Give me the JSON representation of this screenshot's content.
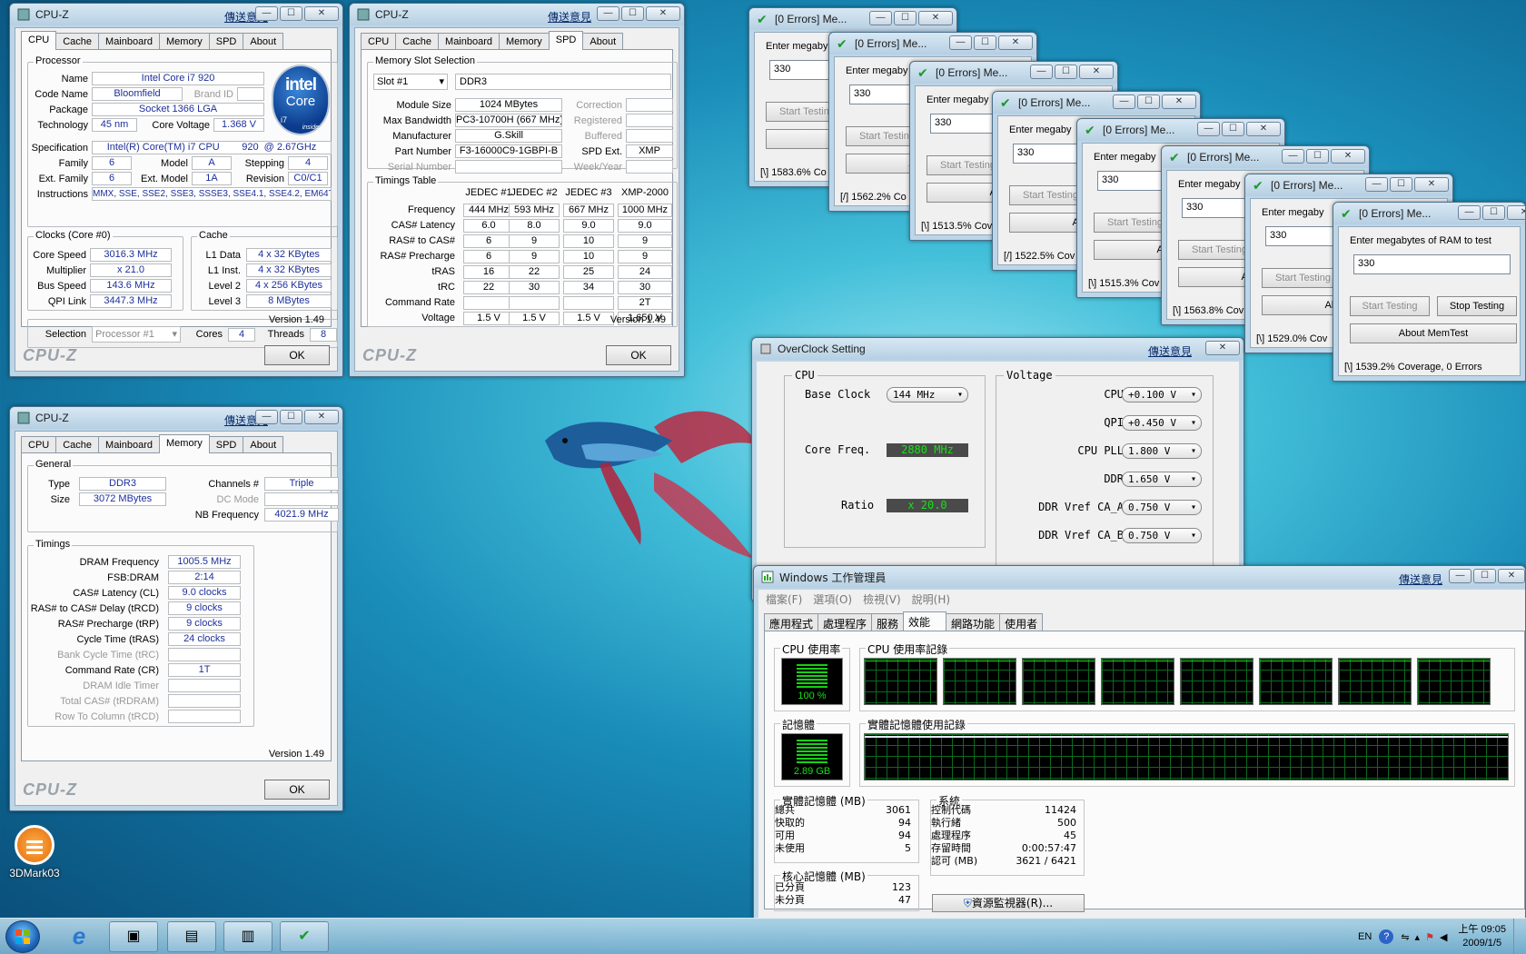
{
  "send_link": "傳送意見",
  "cpuz_logo": "CPU-Z",
  "cpuz_title": "CPU-Z",
  "cpuz_tabs": [
    "CPU",
    "Cache",
    "Mainboard",
    "Memory",
    "SPD",
    "About"
  ],
  "cpuz_version": "Version 1.49",
  "ok_label": "OK",
  "intel_logo": {
    "brand": "intel",
    "sub": "Core",
    "model": "i7",
    "inside": "inside"
  },
  "cpu": {
    "processor_group": "Processor",
    "name_label": "Name",
    "name": "Intel Core i7 920",
    "codename_label": "Code Name",
    "codename": "Bloomfield",
    "brandid_label": "Brand ID",
    "package_label": "Package",
    "package": "Socket 1366 LGA",
    "technology_label": "Technology",
    "technology": "45 nm",
    "core_voltage_label": "Core Voltage",
    "core_voltage": "1.368 V",
    "spec_label": "Specification",
    "spec": "Intel(R) Core(TM) i7 CPU        920  @ 2.67GHz",
    "family_label": "Family",
    "family": "6",
    "model_label": "Model",
    "model": "A",
    "stepping_label": "Stepping",
    "stepping": "4",
    "extfamily_label": "Ext. Family",
    "extfamily": "6",
    "extmodel_label": "Ext. Model",
    "extmodel": "1A",
    "revision_label": "Revision",
    "revision": "C0/C1",
    "instructions_label": "Instructions",
    "instructions": "MMX, SSE, SSE2, SSE3, SSSE3, SSE4.1, SSE4.2, EM64T",
    "clocks_group": "Clocks (Core #0)",
    "core_speed_label": "Core Speed",
    "core_speed": "3016.3 MHz",
    "multiplier_label": "Multiplier",
    "multiplier": "x 21.0",
    "bus_speed_label": "Bus Speed",
    "bus_speed": "143.6 MHz",
    "qpi_label": "QPI Link",
    "qpi": "3447.3 MHz",
    "cache_group": "Cache",
    "l1d_label": "L1 Data",
    "l1d": "4 x 32 KBytes",
    "l1i_label": "L1 Inst.",
    "l1i": "4 x 32 KBytes",
    "l2_label": "Level 2",
    "l2": "4 x 256 KBytes",
    "l3_label": "Level 3",
    "l3": "8 MBytes",
    "selection_label": "Selection",
    "selection": "Processor #1",
    "cores_label": "Cores",
    "cores": "4",
    "threads_label": "Threads",
    "threads": "8"
  },
  "spd": {
    "slot_group": "Memory Slot Selection",
    "slot": "Slot #1",
    "type": "DDR3",
    "module_size_label": "Module Size",
    "module_size": "1024 MBytes",
    "correction_label": "Correction",
    "max_bw_label": "Max Bandwidth",
    "max_bw": "PC3-10700H (667 MHz)",
    "registered_label": "Registered",
    "manufacturer_label": "Manufacturer",
    "manufacturer": "G.Skill",
    "buffered_label": "Buffered",
    "part_label": "Part Number",
    "part": "F3-16000C9-1GBPI-B",
    "spd_ext_label": "SPD Ext.",
    "spd_ext": "XMP",
    "serial_label": "Serial Number",
    "weekyear_label": "Week/Year",
    "timings_group": "Timings Table",
    "columns": [
      "JEDEC #1",
      "JEDEC #2",
      "JEDEC #3",
      "XMP-2000"
    ],
    "rows": [
      {
        "label": "Frequency",
        "values": [
          "444 MHz",
          "593 MHz",
          "667 MHz",
          "1000 MHz"
        ]
      },
      {
        "label": "CAS# Latency",
        "values": [
          "6.0",
          "8.0",
          "9.0",
          "9.0"
        ]
      },
      {
        "label": "RAS# to CAS#",
        "values": [
          "6",
          "9",
          "10",
          "9"
        ]
      },
      {
        "label": "RAS# Precharge",
        "values": [
          "6",
          "9",
          "10",
          "9"
        ]
      },
      {
        "label": "tRAS",
        "values": [
          "16",
          "22",
          "25",
          "24"
        ]
      },
      {
        "label": "tRC",
        "values": [
          "22",
          "30",
          "34",
          "30"
        ]
      },
      {
        "label": "Command Rate",
        "values": [
          "",
          "",
          "",
          "2T"
        ]
      },
      {
        "label": "Voltage",
        "values": [
          "1.5 V",
          "1.5 V",
          "1.5 V",
          "1.650 V"
        ]
      }
    ]
  },
  "memory": {
    "general_group": "General",
    "type_label": "Type",
    "type": "DDR3",
    "channels_label": "Channels #",
    "channels": "Triple",
    "size_label": "Size",
    "size": "3072 MBytes",
    "dcmode_label": "DC Mode",
    "nbfreq_label": "NB Frequency",
    "nbfreq": "4021.9 MHz",
    "timings_group": "Timings",
    "timings": [
      {
        "label": "DRAM Frequency",
        "value": "1005.5 MHz",
        "dim": false
      },
      {
        "label": "FSB:DRAM",
        "value": "2:14",
        "dim": false
      },
      {
        "label": "CAS# Latency (CL)",
        "value": "9.0 clocks",
        "dim": false
      },
      {
        "label": "RAS# to CAS# Delay (tRCD)",
        "value": "9 clocks",
        "dim": false
      },
      {
        "label": "RAS# Precharge (tRP)",
        "value": "9 clocks",
        "dim": false
      },
      {
        "label": "Cycle Time (tRAS)",
        "value": "24 clocks",
        "dim": false
      },
      {
        "label": "Bank Cycle Time (tRC)",
        "value": "",
        "dim": true
      },
      {
        "label": "Command Rate (CR)",
        "value": "1T",
        "dim": false
      },
      {
        "label": "DRAM Idle Timer",
        "value": "",
        "dim": true
      },
      {
        "label": "Total CAS# (tRDRAM)",
        "value": "",
        "dim": true
      },
      {
        "label": "Row To Column (tRCD)",
        "value": "",
        "dim": true
      }
    ]
  },
  "memtest": {
    "title": "[0 Errors] Me...",
    "prompt_short": "Enter megaby",
    "prompt_full": "Enter megabytes of RAM to test",
    "value": "330",
    "start_label": "Start Testing",
    "about_short": "Ab",
    "stop_label": "Stop Testing",
    "about_label": "About MemTest",
    "statuses": [
      "[\\]  1583.6% Co",
      "[/]  1562.2% Co",
      "[\\]  1513.5% Cov",
      "[/]  1522.5% Cov",
      "[\\]  1515.3% Cov",
      "[\\]  1563.8% Cov",
      "[\\]  1529.0% Cov",
      "[\\]  1539.2% Coverage, 0 Errors"
    ]
  },
  "overclock": {
    "title": "OverClock Setting",
    "cpu_group": "CPU",
    "voltage_group": "Voltage",
    "base_clock_label": "Base Clock",
    "base_clock": "144 MHz",
    "core_freq_label": "Core Freq.",
    "core_freq": "2880 MHz",
    "ratio_label": "Ratio",
    "ratio": "x 20.0",
    "volts": [
      {
        "label": "CPU",
        "value": "+0.100 V"
      },
      {
        "label": "QPI",
        "value": "+0.450 V"
      },
      {
        "label": "CPU PLL",
        "value": "1.800 V"
      },
      {
        "label": "DDR",
        "value": "1.650 V"
      },
      {
        "label": "DDR Vref CA_A",
        "value": "0.750 V"
      },
      {
        "label": "DDR Vref CA_B",
        "value": "0.750 V"
      }
    ]
  },
  "taskmgr": {
    "title": "Windows 工作管理員",
    "menu": [
      "檔案(F)",
      "選項(O)",
      "檢視(V)",
      "說明(H)"
    ],
    "tabs": [
      "應用程式",
      "處理程序",
      "服務",
      "效能",
      "網路功能",
      "使用者"
    ],
    "cpu_usage_label": "CPU 使用率",
    "cpu_usage": "100 %",
    "cpu_history_label": "CPU 使用率記錄",
    "mem_label": "記憶體",
    "mem_value": "2.89 GB",
    "mem_history_label": "實體記憶體使用記錄",
    "phys_group": "實體記憶體 (MB)",
    "phys": [
      {
        "k": "總共",
        "v": "3061"
      },
      {
        "k": "快取的",
        "v": "94"
      },
      {
        "k": "可用",
        "v": "94"
      },
      {
        "k": "未使用",
        "v": "5"
      }
    ],
    "kernel_group": "核心記憶體 (MB)",
    "kernel": [
      {
        "k": "已分頁",
        "v": "123"
      },
      {
        "k": "未分頁",
        "v": "47"
      }
    ],
    "system_group": "系統",
    "system": [
      {
        "k": "控制代碼",
        "v": "11424"
      },
      {
        "k": "執行緒",
        "v": "500"
      },
      {
        "k": "處理程序",
        "v": "45"
      },
      {
        "k": "存留時間",
        "v": "0:00:57:47"
      },
      {
        "k": "認可 (MB)",
        "v": "3621 / 6421"
      }
    ],
    "resmon_label": "資源監視器(R)..."
  },
  "desktop_icon": "3DMark03",
  "tray": {
    "lang": "EN",
    "time": "上午 09:05",
    "date": "2009/1/5"
  }
}
